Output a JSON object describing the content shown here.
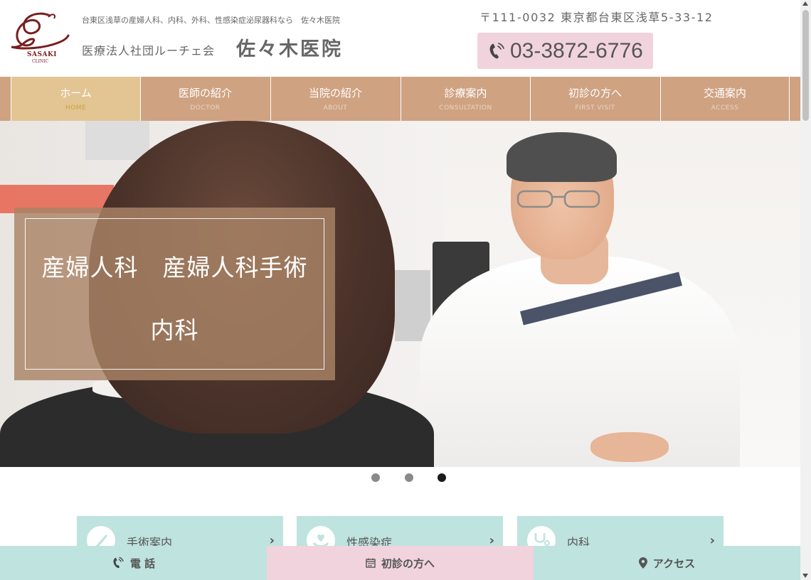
{
  "header": {
    "logo_text": "SASAKI",
    "logo_subtext": "CLINIC",
    "tagline": "台東区浅草の産婦人科、内科、外科、性感染症泌尿器科なら　佐々木医院",
    "corporation": "医療法人社団ルーチェ会",
    "clinic_name": "佐々木医院",
    "address": "〒111-0032 東京都台東区浅草5-33-12",
    "phone": "03-3872-6776"
  },
  "nav": {
    "items": [
      {
        "label": "ホーム",
        "sub": "HOME"
      },
      {
        "label": "医師の紹介",
        "sub": "DOCTOR"
      },
      {
        "label": "当院の紹介",
        "sub": "ABOUT"
      },
      {
        "label": "診療案内",
        "sub": "CONSULTATION"
      },
      {
        "label": "初診の方へ",
        "sub": "FIRST VISIT"
      },
      {
        "label": "交通案内",
        "sub": "ACCESS"
      }
    ],
    "active_index": 0
  },
  "hero": {
    "line1": "産婦人科　産婦人科手術",
    "line2": "内科",
    "slide_count": 3,
    "active_slide": 2
  },
  "cards": [
    {
      "label": "手術案内",
      "icon": "scalpel-icon"
    },
    {
      "label": "性感染症",
      "icon": "heart-hands-icon"
    },
    {
      "label": "内科",
      "icon": "stethoscope-icon"
    }
  ],
  "bottom_bar": {
    "phone_label": "電 話",
    "first_visit_label": "初診の方へ",
    "access_label": "アクセス"
  },
  "colors": {
    "nav_bg": "#cfa282",
    "nav_active": "#e3c594",
    "phone_box": "#f1d3dd",
    "card_bg": "#bfe3df",
    "bottom_first_visit": "#f1d3dd",
    "logo": "#7a1e1e"
  }
}
